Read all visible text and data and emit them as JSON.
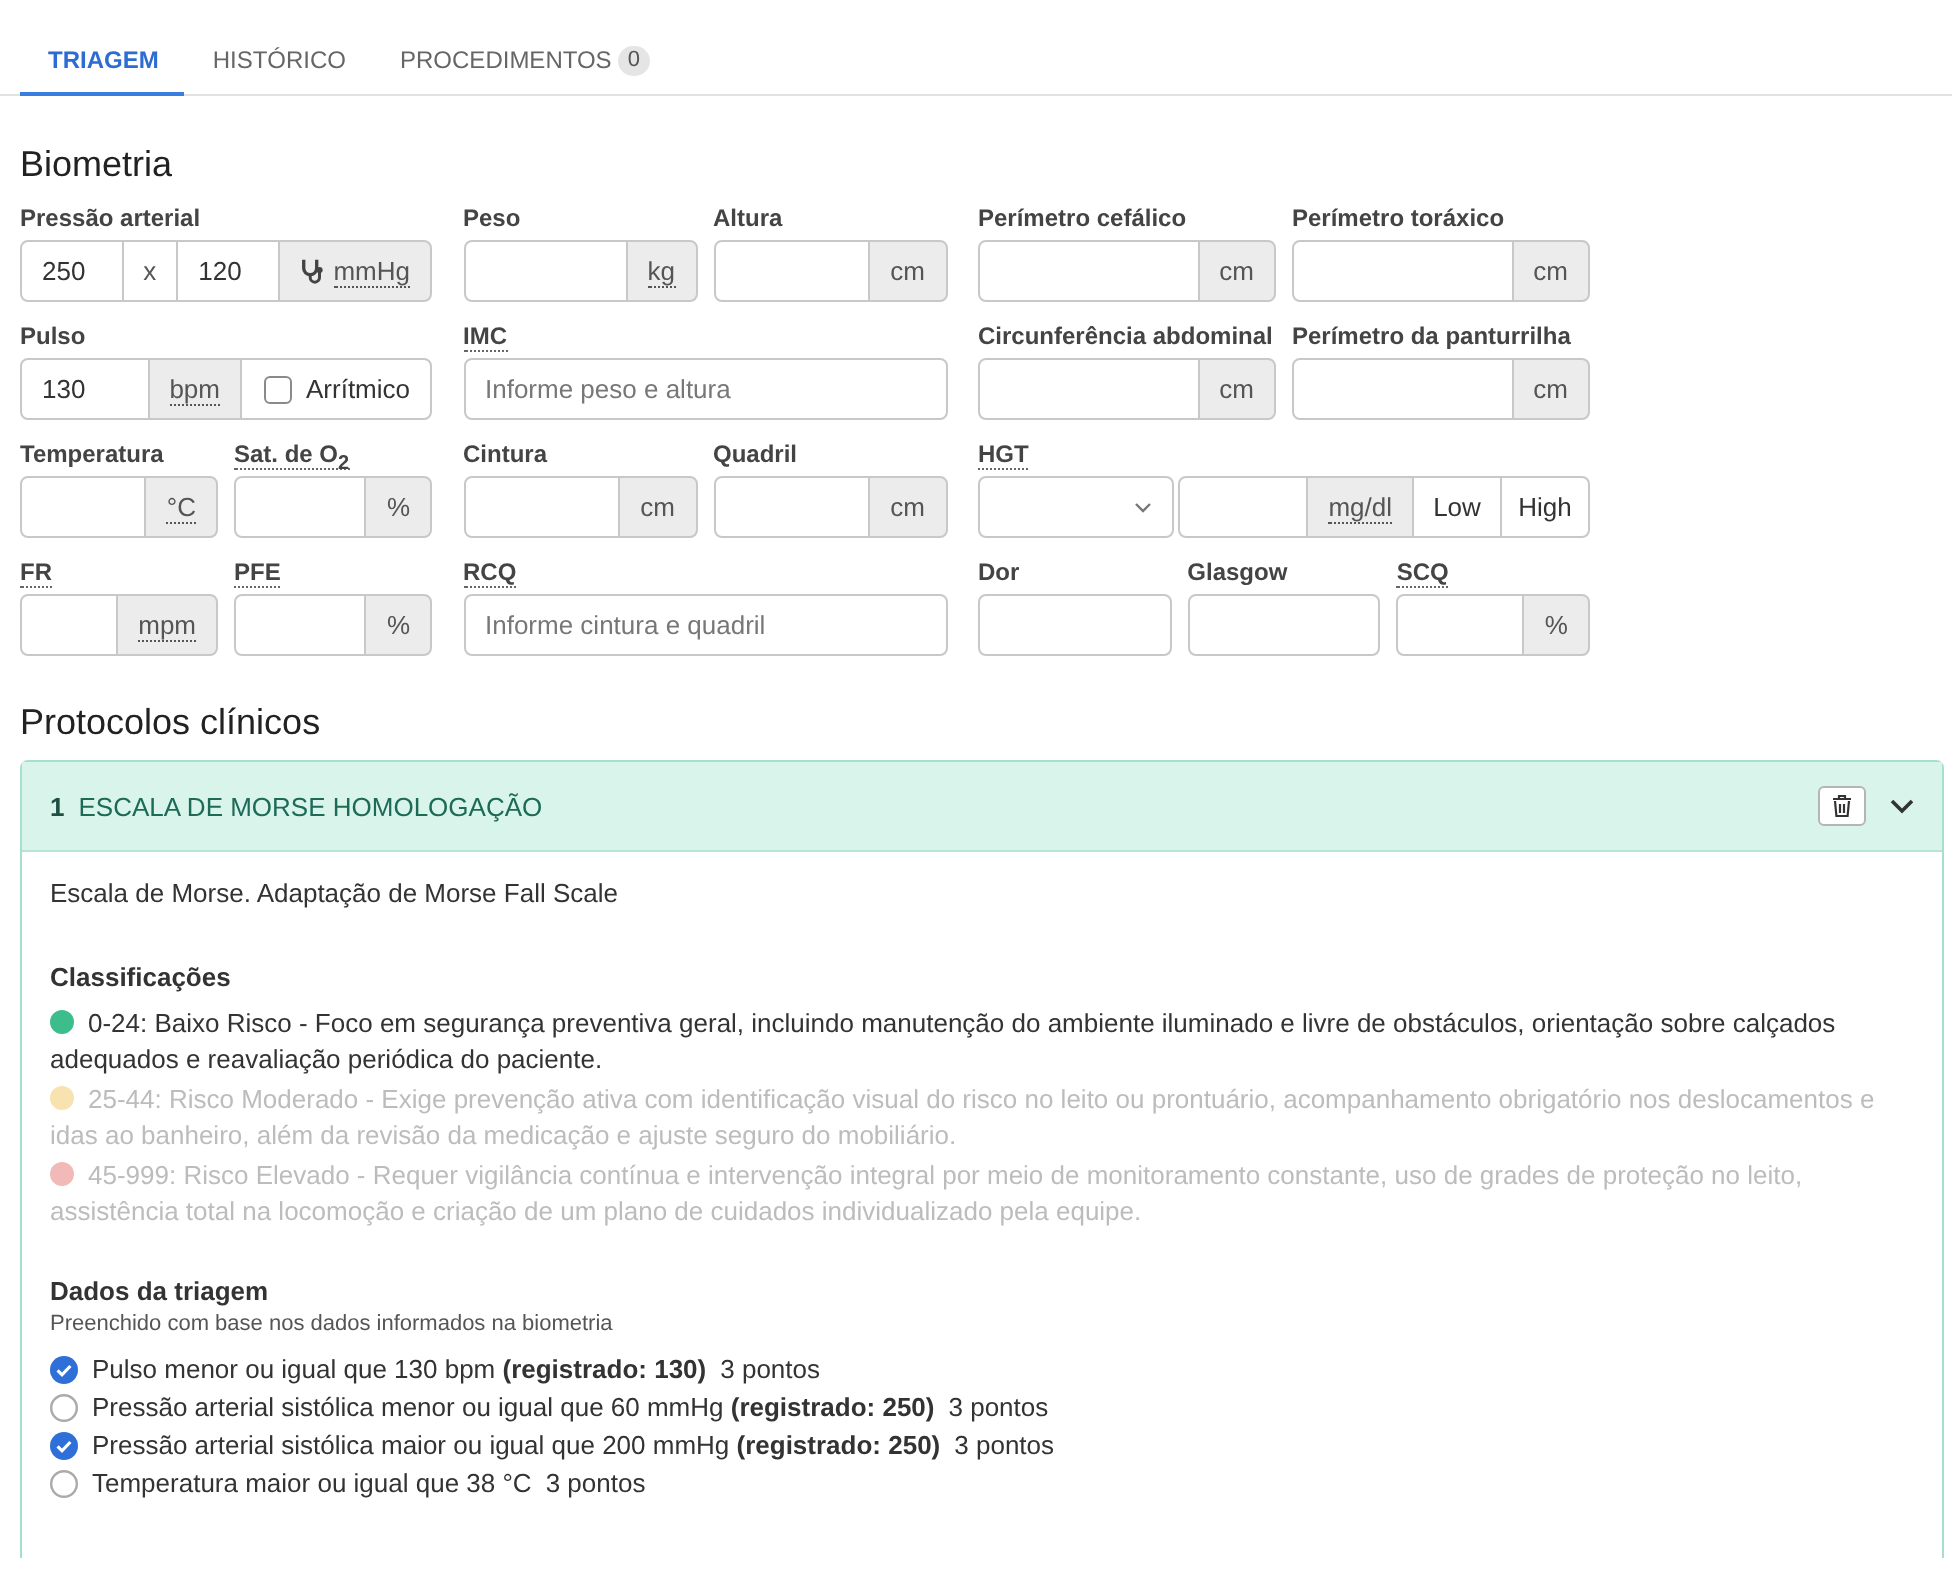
{
  "tabs": [
    {
      "label": "TRIAGEM",
      "selected": true
    },
    {
      "label": "HISTÓRICO",
      "selected": false
    },
    {
      "label": "PROCEDIMENTOS",
      "badge": "0",
      "selected": false
    }
  ],
  "biometria": {
    "title": "Biometria",
    "rows": [
      [
        [
          {
            "kind": "pressure",
            "label": "Pressão arterial",
            "label_abbr": false,
            "value": "250",
            "separator": "x",
            "value2": "120",
            "unit": "mmHg",
            "unit_abbr": true
          }
        ],
        [
          {
            "kind": "unit",
            "label": "Peso",
            "label_abbr": false,
            "unit": "kg",
            "unit_abbr": true
          },
          {
            "kind": "unit",
            "label": "Altura",
            "label_abbr": false,
            "unit": "cm",
            "unit_abbr": false
          }
        ],
        [
          {
            "kind": "unit",
            "label": "Perímetro cefálico",
            "label_abbr": false,
            "unit": "cm",
            "unit_abbr": false
          },
          {
            "kind": "unit",
            "label": "Perímetro toráxico",
            "label_abbr": false,
            "unit": "cm",
            "unit_abbr": false
          }
        ]
      ],
      [
        [
          {
            "kind": "pulse",
            "label": "Pulso",
            "label_abbr": false,
            "value": "130",
            "unit": "bpm",
            "unit_abbr": true,
            "checkbox": {
              "label": "Arrítmico",
              "checked": false
            }
          }
        ],
        [
          {
            "kind": "text",
            "label": "IMC",
            "label_abbr": true,
            "placeholder": "Informe peso e altura"
          }
        ],
        [
          {
            "kind": "unit",
            "label": "Circunferência abdominal",
            "label_abbr": false,
            "unit": "cm",
            "unit_abbr": false
          },
          {
            "kind": "unit",
            "label": "Perímetro da panturrilha",
            "label_abbr": false,
            "unit": "cm",
            "unit_abbr": false
          }
        ]
      ],
      [
        [
          {
            "kind": "unit",
            "label": "Temperatura",
            "label_abbr": false,
            "unit": "°C",
            "unit_abbr": true
          },
          {
            "kind": "unit",
            "label": "Sat. de O$_{2}$",
            "label_abbr": true,
            "unit": "%",
            "unit_abbr": false
          }
        ],
        [
          {
            "kind": "unit",
            "label": "Cintura",
            "label_abbr": false,
            "unit": "cm",
            "unit_abbr": false
          },
          {
            "kind": "unit",
            "label": "Quadril",
            "label_abbr": false,
            "unit": "cm",
            "unit_abbr": false
          }
        ],
        [
          {
            "kind": "hgt",
            "label": "HGT",
            "label_abbr": true,
            "unit": "mg/dl",
            "unit_abbr": true,
            "buttons": [
              "Low",
              "High"
            ]
          }
        ]
      ],
      [
        [
          {
            "kind": "unit",
            "label": "FR",
            "label_abbr": true,
            "unit": "mpm",
            "unit_abbr": true
          },
          {
            "kind": "unit",
            "label": "PFE",
            "label_abbr": true,
            "unit": "%",
            "unit_abbr": false
          }
        ],
        [
          {
            "kind": "text",
            "label": "RCQ",
            "label_abbr": true,
            "placeholder": "Informe cintura e quadril"
          }
        ],
        [
          {
            "kind": "plain",
            "label": "Dor",
            "label_abbr": false
          },
          {
            "kind": "plain",
            "label": "Glasgow",
            "label_abbr": false
          },
          {
            "kind": "unit",
            "label": "SCQ",
            "label_abbr": true,
            "unit": "%",
            "unit_abbr": false
          }
        ]
      ]
    ]
  },
  "protocols": {
    "title": "Protocolos clínicos",
    "items": [
      {
        "number": "1",
        "title": "ESCALA DE MORSE HOMOLOGAÇÃO",
        "expanded": true,
        "description": "Escala de Morse. Adaptação de Morse Fall Scale",
        "classifications": {
          "title": "Classificações",
          "items": [
            {
              "text": "0-24: Baixo Risco - Foco em segurança preventiva geral, incluindo manutenção do ambiente iluminado e livre de obstáculos, orientação sobre calçados adequados e reavaliação periódica do paciente.",
              "color": "#3dbd8b",
              "active": true
            },
            {
              "text": "25-44: Risco Moderado - Exige prevenção ativa com identificação visual do risco no leito ou prontuário, acompanhamento obrigatório nos deslocamentos e idas ao banheiro, além da revisão da medicação e ajuste seguro do mobiliário.",
              "color": "#f8e2b0",
              "active": false
            },
            {
              "text": "45-999: Risco Elevado - Requer vigilância contínua e intervenção integral por meio de monitoramento constante, uso de grades de proteção no leito, assistência total na locomoção e criação de um plano de cuidados individualizado pela equipe.",
              "color": "#f2b9b9",
              "active": false
            }
          ]
        },
        "triage": {
          "title": "Dados da triagem",
          "subtitle": "Preenchido com base nos dados informados na biometria",
          "items": [
            {
              "text": "Pulso menor ou igual que 130 bpm **(registrado: 130)**",
              "points": "3 pontos",
              "checked": true
            },
            {
              "text": "Pressão arterial sistólica menor ou igual que 60 mmHg **(registrado: 250)**",
              "points": "3 pontos",
              "checked": false
            },
            {
              "text": "Pressão arterial sistólica maior ou igual que 200 mmHg **(registrado: 250)**",
              "points": "3 pontos",
              "checked": true
            },
            {
              "text": "Temperatura maior ou igual que 38 °C",
              "points": "3 pontos",
              "checked": false
            }
          ]
        }
      }
    ]
  }
}
